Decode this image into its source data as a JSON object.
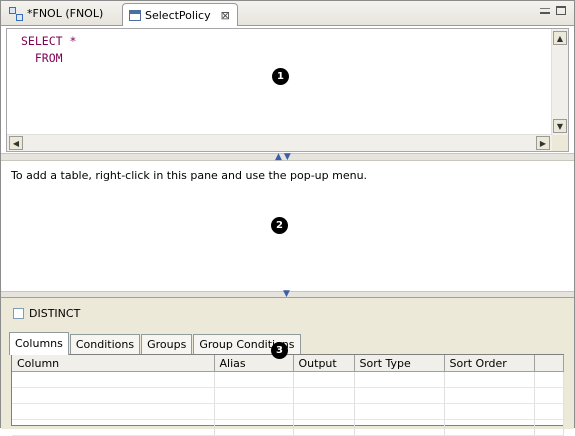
{
  "tabs": [
    {
      "label": "*FNOL (FNOL)",
      "icon": "data-object-icon"
    },
    {
      "label": "SelectPolicy",
      "icon": "sql-file-icon",
      "close": "⊠"
    }
  ],
  "editor": {
    "lines": [
      "SELECT *",
      "  FROM"
    ],
    "keyword_color": "#7f0055"
  },
  "diagram": {
    "hint": "To add a table, right-click in this pane and use the pop-up menu."
  },
  "options": {
    "distinct_label": "DISTINCT",
    "distinct_checked": false
  },
  "bottom_tabs": [
    "Columns",
    "Conditions",
    "Groups",
    "Group Conditions"
  ],
  "active_bottom_tab": "Columns",
  "grid": {
    "columns": [
      "Column",
      "Alias",
      "Output",
      "Sort Type",
      "Sort Order",
      ""
    ]
  },
  "callouts": [
    "1",
    "2",
    "3"
  ]
}
